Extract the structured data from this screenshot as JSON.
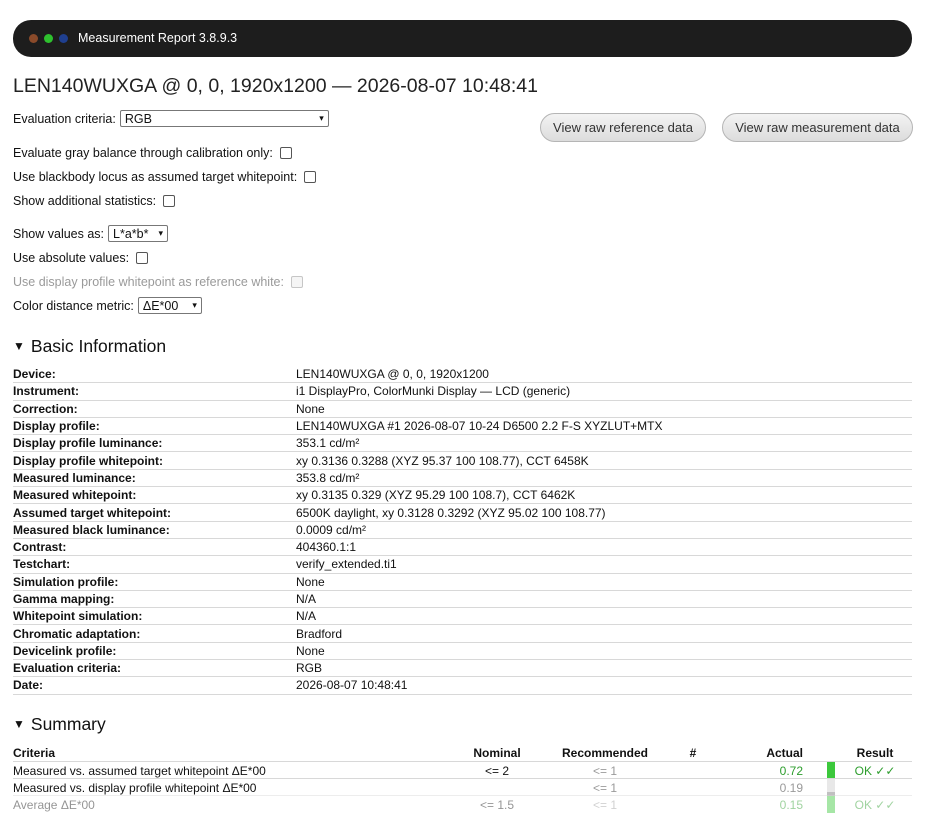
{
  "window": {
    "title": "Measurement Report 3.8.9.3",
    "dot_colors": [
      "#8a4a2a",
      "#2ec02e",
      "#1f3f8f"
    ]
  },
  "report_title": "LEN140WUXGA @ 0, 0, 1920x1200 — 2026-08-07 10:48:41",
  "controls": {
    "evaluation_criteria_label": "Evaluation criteria:",
    "evaluation_criteria_value": "RGB",
    "gray_balance_label": "Evaluate gray balance through calibration only:",
    "blackbody_label": "Use blackbody locus as assumed target whitepoint:",
    "additional_stats_label": "Show additional statistics:",
    "show_values_label": "Show values as:",
    "show_values_value": "L*a*b*",
    "absolute_values_label": "Use absolute values:",
    "profile_whitepoint_label": "Use display profile whitepoint as reference white:",
    "distance_metric_label": "Color distance metric:",
    "distance_metric_value": "ΔE*00"
  },
  "buttons": {
    "raw_reference": "View raw reference data",
    "raw_measurement": "View raw measurement data"
  },
  "icons": {
    "dropdown": "▾",
    "expanded": "▼",
    "checkmark": "check-icon"
  },
  "basic_info": {
    "heading": "Basic Information",
    "rows": [
      {
        "key": "Device:",
        "value": "LEN140WUXGA @ 0, 0, 1920x1200"
      },
      {
        "key": "Instrument:",
        "value": "i1 DisplayPro, ColorMunki Display — LCD (generic)"
      },
      {
        "key": "Correction:",
        "value": "None"
      },
      {
        "key": "Display profile:",
        "value": "LEN140WUXGA #1 2026-08-07 10-24 D6500 2.2 F-S XYZLUT+MTX"
      },
      {
        "key": "Display profile luminance:",
        "value": "353.1 cd/m²"
      },
      {
        "key": "Display profile whitepoint:",
        "value": "xy 0.3136 0.3288 (XYZ 95.37 100 108.77), CCT 6458K"
      },
      {
        "key": "Measured luminance:",
        "value": "353.8 cd/m²"
      },
      {
        "key": "Measured whitepoint:",
        "value": "xy 0.3135 0.329 (XYZ 95.29 100 108.7), CCT 6462K"
      },
      {
        "key": "Assumed target whitepoint:",
        "value": "6500K daylight, xy 0.3128 0.3292 (XYZ 95.02 100 108.77)"
      },
      {
        "key": "Measured black luminance:",
        "value": "0.0009 cd/m²"
      },
      {
        "key": "Contrast:",
        "value": "404360.1:1"
      },
      {
        "key": "Testchart:",
        "value": "verify_extended.ti1"
      },
      {
        "key": "Simulation profile:",
        "value": "None"
      },
      {
        "key": "Gamma mapping:",
        "value": "N/A"
      },
      {
        "key": "Whitepoint simulation:",
        "value": "N/A"
      },
      {
        "key": "Chromatic adaptation:",
        "value": "Bradford"
      },
      {
        "key": "Devicelink profile:",
        "value": "None"
      },
      {
        "key": "Evaluation criteria:",
        "value": "RGB"
      },
      {
        "key": "Date:",
        "value": "2026-08-07 10:48:41"
      }
    ]
  },
  "summary": {
    "heading": "Summary",
    "columns": {
      "criteria": "Criteria",
      "nominal": "Nominal",
      "recommended": "Recommended",
      "hash": "#",
      "actual": "Actual",
      "result": "Result"
    },
    "rows": [
      {
        "criteria": "Measured vs. assumed target whitepoint ΔE*00",
        "nominal": "<= 2",
        "recommended": "<= 1",
        "actual": "0.72",
        "result": "OK ✓✓",
        "bar_fraction": 1.0,
        "bar_color": "#3cc83c"
      },
      {
        "criteria": "Measured vs. display profile whitepoint ΔE*00",
        "nominal": "",
        "recommended": "<= 1",
        "actual": "0.19",
        "result": "",
        "bar_fraction": 0.25,
        "bar_color": "#c0c0c0"
      },
      {
        "criteria": "Average ΔE*00",
        "nominal": "<= 1.5",
        "recommended": "<= 1",
        "actual": "0.15",
        "result": "OK ✓✓",
        "bar_fraction": 1.0,
        "bar_color": "#3cc83c"
      }
    ]
  }
}
